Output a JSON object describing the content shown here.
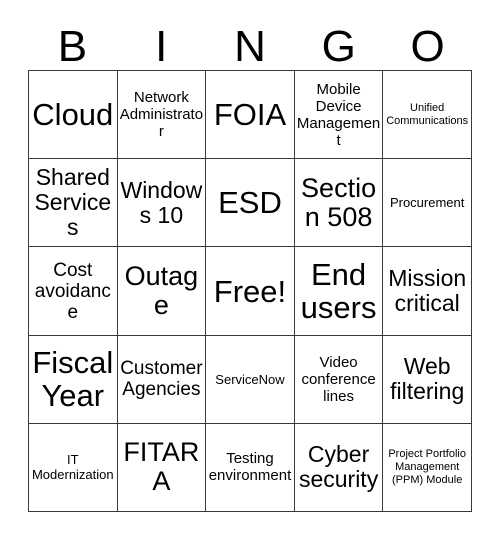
{
  "header": {
    "letters": [
      "B",
      "I",
      "N",
      "G",
      "O"
    ]
  },
  "grid": {
    "columns": 5,
    "rows": 5,
    "free_space_label": "Free!",
    "free_space_position": {
      "row": 3,
      "column": 3
    },
    "cells": [
      [
        {
          "label": "Cloud",
          "size": "sz-xxl"
        },
        {
          "label": "Network Administrator",
          "size": "sz-sm"
        },
        {
          "label": "FOIA",
          "size": "sz-xxl"
        },
        {
          "label": "Mobile Device Management",
          "size": "sz-sm"
        },
        {
          "label": "Unified Communications",
          "size": "sz-xxs"
        }
      ],
      [
        {
          "label": "Shared Services",
          "size": "sz-lg"
        },
        {
          "label": "Windows 10",
          "size": "sz-lg"
        },
        {
          "label": "ESD",
          "size": "sz-xxl"
        },
        {
          "label": "Section 508",
          "size": "sz-xl"
        },
        {
          "label": "Procurement",
          "size": "sz-xs"
        }
      ],
      [
        {
          "label": "Cost avoidance",
          "size": "sz-md"
        },
        {
          "label": "Outage",
          "size": "sz-xl"
        },
        {
          "label": "Free!",
          "size": "sz-xxl"
        },
        {
          "label": "End users",
          "size": "sz-xxl"
        },
        {
          "label": "Mission critical",
          "size": "sz-lg"
        }
      ],
      [
        {
          "label": "Fiscal Year",
          "size": "sz-xxl"
        },
        {
          "label": "Customer Agencies",
          "size": "sz-md"
        },
        {
          "label": "ServiceNow",
          "size": "sz-xs"
        },
        {
          "label": "Video conference lines",
          "size": "sz-sm"
        },
        {
          "label": "Web filtering",
          "size": "sz-lg"
        }
      ],
      [
        {
          "label": "IT Modernization",
          "size": "sz-xs"
        },
        {
          "label": "FITARA",
          "size": "sz-xl"
        },
        {
          "label": "Testing environment",
          "size": "sz-sm"
        },
        {
          "label": "Cyber security",
          "size": "sz-lg"
        },
        {
          "label": "Project Portfolio Management (PPM) Module",
          "size": "sz-xxs"
        }
      ]
    ]
  },
  "colors": {
    "background": "#ffffff",
    "text": "#000000",
    "grid_line": "#3a3a3a"
  }
}
